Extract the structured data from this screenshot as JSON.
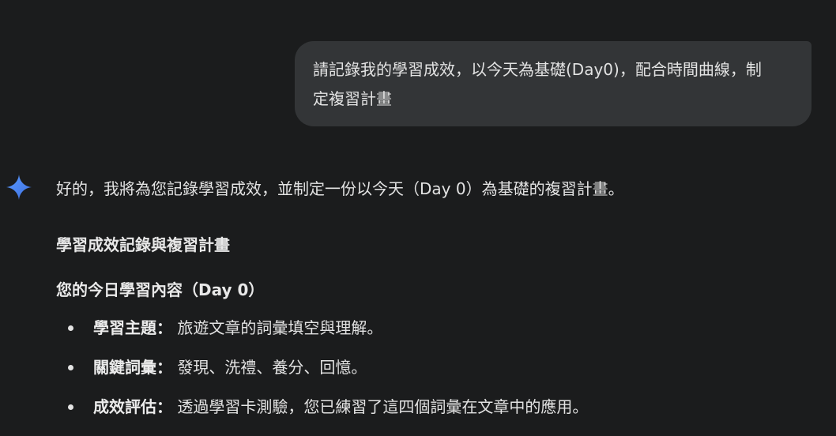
{
  "user_message": {
    "line1": "請記錄我的學習成效，以今天為基礎(Day0)，配合時間曲線，制",
    "line2": "定複習計畫"
  },
  "ai_icon": "gemini-sparkle-icon",
  "accent_colors": [
    "#4f8cf7",
    "#3b6fe0"
  ],
  "response": {
    "intro": "好的，我將為您記錄學習成效，並制定一份以今天（Day 0）為基礎的複習計畫。",
    "heading1": "學習成效記錄與複習計畫",
    "heading2": "您的今日學習內容（Day 0）",
    "bullets": [
      {
        "term": "學習主題：",
        "text": " 旅遊文章的詞彙填空與理解。"
      },
      {
        "term": "關鍵詞彙：",
        "text": " 發現、洗禮、養分、回憶。"
      },
      {
        "term": "成效評估：",
        "text": " 透過學習卡測驗，您已練習了這四個詞彙在文章中的應用。"
      }
    ]
  }
}
